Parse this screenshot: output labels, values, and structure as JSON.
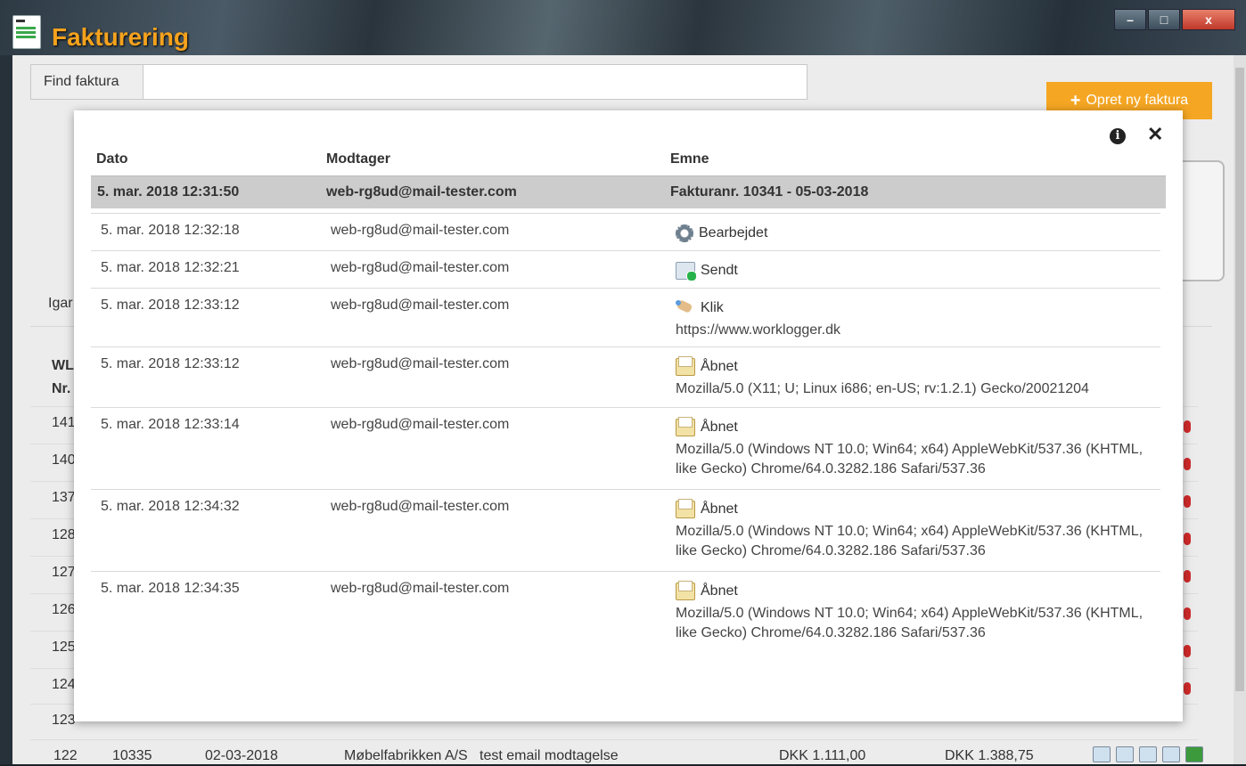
{
  "window": {
    "title": "Fakturering",
    "controls": {
      "minimize": "–",
      "maximize": "□",
      "close": "x"
    }
  },
  "toolbar": {
    "find_label": "Find faktura",
    "find_value": "",
    "new_invoice_label": "Opret ny faktura",
    "new_invoice_icon": "plus-icon"
  },
  "background": {
    "period_label": "Igar",
    "table_header_wl": "WL",
    "table_header_nr": "Nr.",
    "row_ids": [
      "141",
      "140",
      "137",
      "128",
      "127",
      "126",
      "125",
      "124",
      "123"
    ],
    "last_row": {
      "wl_nr": "122",
      "invoice_no": "10335",
      "date": "02-03-2018",
      "customer": "Møbelfabrikken A/S",
      "subject": "test email modtagelse",
      "amount": "DKK 1.111,00",
      "amount_incl": "DKK 1.388,75"
    }
  },
  "modal": {
    "info_icon": "info-icon",
    "close_icon": "close-icon",
    "headers": {
      "date": "Dato",
      "recipient": "Modtager",
      "subject": "Emne"
    },
    "highlight": {
      "date": "5. mar. 2018 12:31:50",
      "recipient": "web-rg8ud@mail-tester.com",
      "subject": "Fakturanr. 10341 - 05-03-2018"
    },
    "events": [
      {
        "date": "5. mar. 2018 12:32:18",
        "recipient": "web-rg8ud@mail-tester.com",
        "icon": "gear-icon",
        "status": "Bearbejdet",
        "detail": ""
      },
      {
        "date": "5. mar. 2018 12:32:21",
        "recipient": "web-rg8ud@mail-tester.com",
        "icon": "mail-sent-icon",
        "status": "Sendt",
        "detail": ""
      },
      {
        "date": "5. mar. 2018 12:33:12",
        "recipient": "web-rg8ud@mail-tester.com",
        "icon": "click-icon",
        "status": "Klik",
        "detail": "https://www.worklogger.dk"
      },
      {
        "date": "5. mar. 2018 12:33:12",
        "recipient": "web-rg8ud@mail-tester.com",
        "icon": "mail-open-icon",
        "status": "Åbnet",
        "detail": "Mozilla/5.0 (X11; U; Linux i686; en-US; rv:1.2.1) Gecko/20021204"
      },
      {
        "date": "5. mar. 2018 12:33:14",
        "recipient": "web-rg8ud@mail-tester.com",
        "icon": "mail-open-icon",
        "status": "Åbnet",
        "detail": "Mozilla/5.0 (Windows NT 10.0; Win64; x64) AppleWebKit/537.36 (KHTML, like Gecko) Chrome/64.0.3282.186 Safari/537.36"
      },
      {
        "date": "5. mar. 2018 12:34:32",
        "recipient": "web-rg8ud@mail-tester.com",
        "icon": "mail-open-icon",
        "status": "Åbnet",
        "detail": "Mozilla/5.0 (Windows NT 10.0; Win64; x64) AppleWebKit/537.36 (KHTML, like Gecko) Chrome/64.0.3282.186 Safari/537.36"
      },
      {
        "date": "5. mar. 2018 12:34:35",
        "recipient": "web-rg8ud@mail-tester.com",
        "icon": "mail-open-icon",
        "status": "Åbnet",
        "detail": "Mozilla/5.0 (Windows NT 10.0; Win64; x64) AppleWebKit/537.36 (KHTML, like Gecko) Chrome/64.0.3282.186 Safari/537.36"
      }
    ]
  },
  "colors": {
    "accent": "#f5a623",
    "title": "#f5a21d",
    "highlight_row": "#cccccc"
  }
}
